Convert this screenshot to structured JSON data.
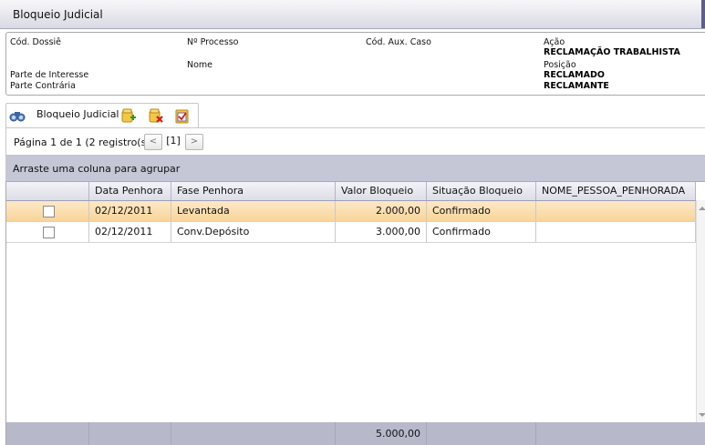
{
  "window": {
    "title": "Bloqueio Judicial"
  },
  "info": {
    "cod_dossie_label": "Cód. Dossiê",
    "n_processo_label": "Nº Processo",
    "cod_aux_caso_label": "Cód. Aux. Caso",
    "acao_label": "Ação",
    "acao_value": "RECLAMAÇÃO TRABALHISTA",
    "nome_label": "Nome",
    "posicao_label": "Posição",
    "parte_interesse_label": "Parte de Interesse",
    "parte_interesse_value": "RECLAMADO",
    "parte_contraria_label": "Parte Contrária",
    "parte_contraria_value": "RECLAMANTE"
  },
  "toolbar": {
    "label": "Bloqueio Judicial",
    "icons": [
      "binoculars-icon",
      "add-icon",
      "delete-icon",
      "edit-checklist-icon"
    ]
  },
  "pager": {
    "text": "Página 1 de 1 (2 registro(s))",
    "prev": "<",
    "current": "[1]",
    "next": ">"
  },
  "group_hint": "Arraste uma coluna para agrupar",
  "grid": {
    "columns": [
      "",
      "Data Penhora",
      "Fase Penhora",
      "Valor Bloqueio",
      "Situação Bloqueio",
      "NOME_PESSOA_PENHORADA"
    ],
    "rows": [
      {
        "data": "02/12/2011",
        "fase": "Levantada",
        "valor": "2.000,00",
        "situacao": "Confirmado",
        "nome": "",
        "selected": true
      },
      {
        "data": "02/12/2011",
        "fase": "Conv.Depósito",
        "valor": "3.000,00",
        "situacao": "Confirmado",
        "nome": "",
        "selected": false
      }
    ],
    "footer_total": "5.000,00"
  },
  "colors": {
    "selected_row": "#f8d49a",
    "group_bar": "#c5c7d6",
    "footer": "#b7b9cb"
  }
}
